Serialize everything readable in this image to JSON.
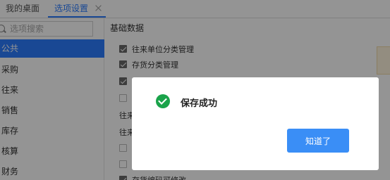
{
  "tabs": {
    "home_label": "我的桌面",
    "settings_label": "选项设置"
  },
  "search": {
    "placeholder": "选项搜索"
  },
  "sidebar": {
    "items": [
      {
        "label": "公共"
      },
      {
        "label": "采购"
      },
      {
        "label": "往来"
      },
      {
        "label": "销售"
      },
      {
        "label": "库存"
      },
      {
        "label": "核算"
      },
      {
        "label": "财务"
      }
    ]
  },
  "main": {
    "section_title": "基础数据",
    "options": [
      {
        "label": "往来单位分类管理",
        "checked": true
      },
      {
        "label": "存货分类管理",
        "checked": true
      },
      {
        "label": "",
        "checked": true
      },
      {
        "label": "",
        "checked": false
      }
    ],
    "labels": [
      "往来",
      "往来"
    ],
    "options_lower": [
      {
        "label": "",
        "checked": false
      },
      {
        "label": "",
        "checked": false
      },
      {
        "label": "存货编码可修改",
        "checked": true
      }
    ]
  },
  "dialog": {
    "message": "保存成功",
    "ok_label": "知道了"
  },
  "colors": {
    "accent": "#2b7cff",
    "success": "#1aa34a",
    "button": "#3a8ef6"
  }
}
